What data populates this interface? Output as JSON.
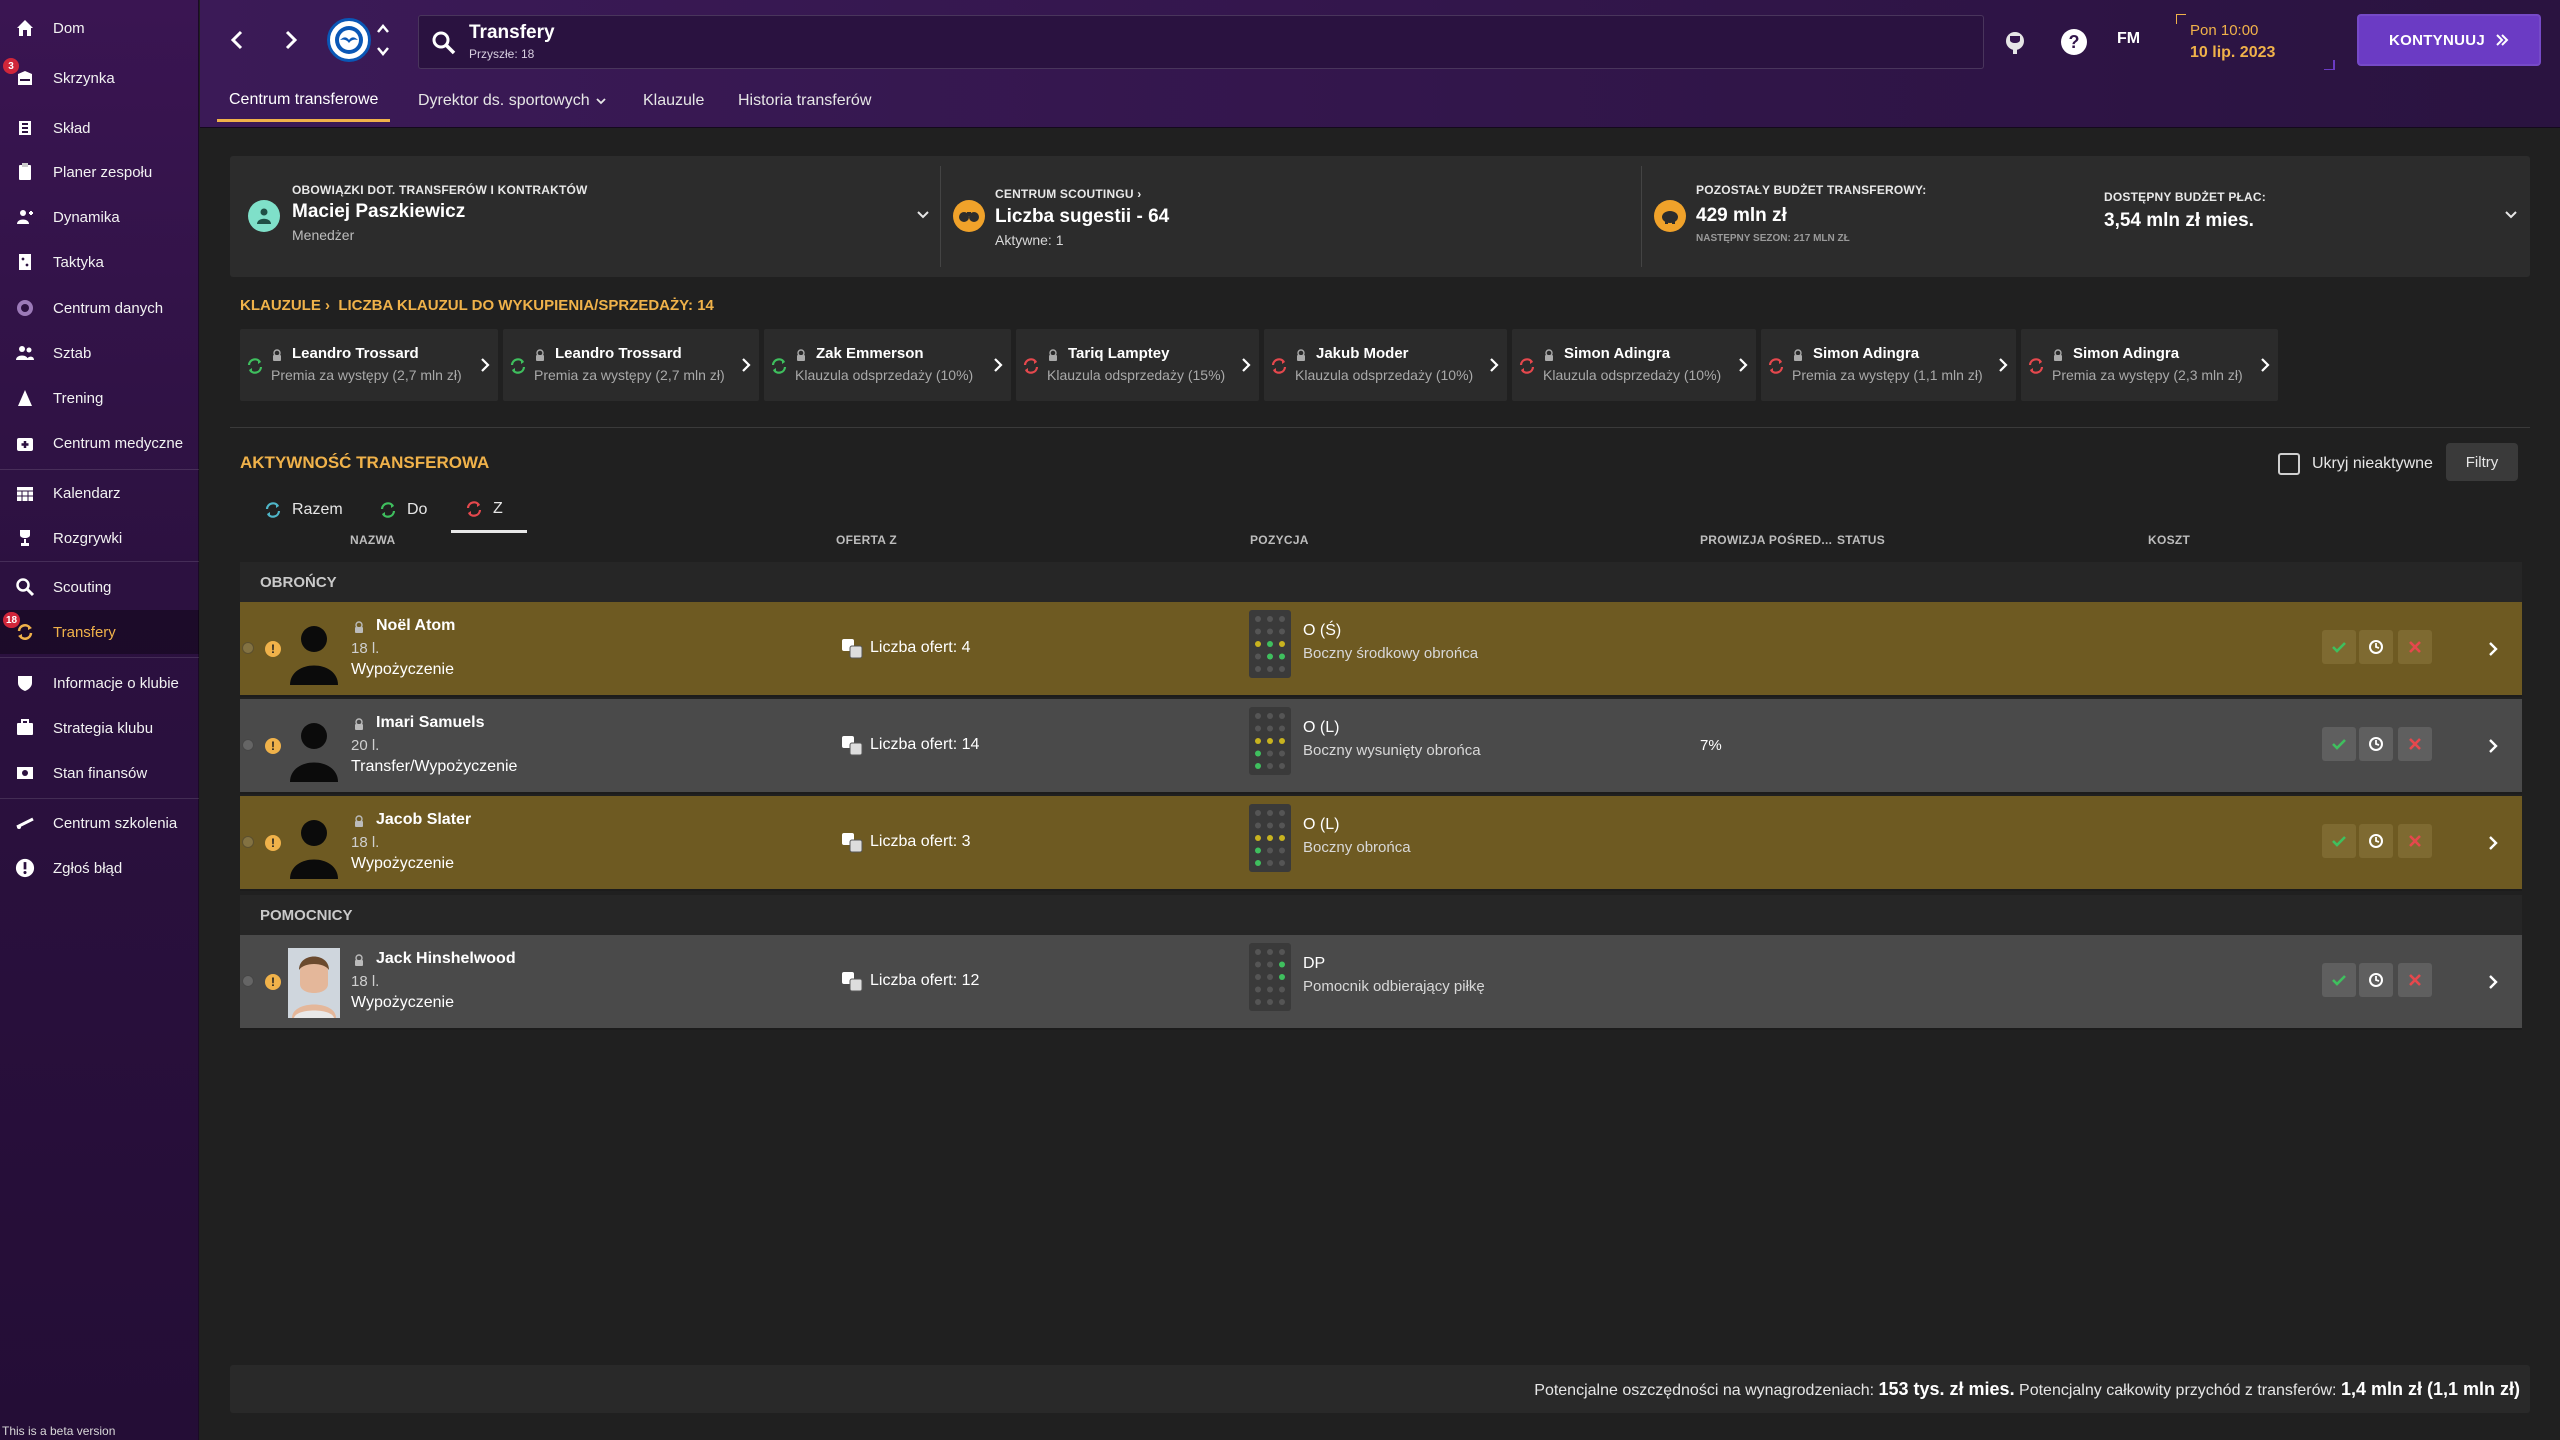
{
  "sidebar": {
    "items": [
      {
        "label": "Dom",
        "icon": "home-icon"
      },
      {
        "label": "Skrzynka",
        "icon": "inbox-icon",
        "badge": "3"
      },
      {
        "label": "Skład",
        "icon": "squad-icon"
      },
      {
        "label": "Planer zespołu",
        "icon": "clipboard-icon"
      },
      {
        "label": "Dynamika",
        "icon": "dynamics-icon"
      },
      {
        "label": "Taktyka",
        "icon": "tactics-icon"
      },
      {
        "label": "Centrum danych",
        "icon": "data-icon"
      },
      {
        "label": "Sztab",
        "icon": "staff-icon"
      },
      {
        "label": "Trening",
        "icon": "training-icon"
      },
      {
        "label": "Centrum medyczne",
        "icon": "medical-icon"
      },
      {
        "label": "Kalendarz",
        "icon": "calendar-icon"
      },
      {
        "label": "Rozgrywki",
        "icon": "trophy-icon"
      },
      {
        "label": "Scouting",
        "icon": "search-icon"
      },
      {
        "label": "Transfery",
        "icon": "transfer-icon",
        "badge": "18"
      },
      {
        "label": "Informacje o klubie",
        "icon": "shield-icon"
      },
      {
        "label": "Strategia klubu",
        "icon": "strategy-icon"
      },
      {
        "label": "Stan finansów",
        "icon": "finances-icon"
      },
      {
        "label": "Centrum szkolenia",
        "icon": "pitch-icon"
      },
      {
        "label": "Zgłoś błąd",
        "icon": "bug-report-icon"
      }
    ],
    "beta_note": "This is a beta version"
  },
  "header": {
    "title": "Transfery",
    "subtitle": "Przyszłe: 18",
    "fm_label": "FM",
    "time": "Pon 10:00",
    "date": "10 lip. 2023",
    "continue_label": "KONTYNUUJ",
    "tabs": [
      "Centrum transferowe",
      "Dyrektor ds. sportowych",
      "Klauzule",
      "Historia transferów"
    ]
  },
  "summary": {
    "duties_caption": "OBOWIĄZKI DOT. TRANSFERÓW I KONTRAKTÓW",
    "duties_name": "Maciej Paszkiewicz",
    "duties_role": "Menedżer",
    "scouting_caption": "CENTRUM SCOUTINGU",
    "scouting_value": "Liczba sugestii - 64",
    "scouting_active": "Aktywne: 1",
    "budget_caption": "POZOSTAŁY BUDŻET TRANSFEROWY:",
    "budget_value": "429 mln zł",
    "budget_next": "NASTĘPNY SEZON: 217 MLN ZŁ",
    "wage_caption": "DOSTĘPNY BUDŻET PŁAC:",
    "wage_value": "3,54 mln zł mies."
  },
  "clauses": {
    "title_link": "KLAUZULE",
    "title_count": "LICZBA KLAUZUL DO WYKUPIENIA/SPRZEDAŻY: 14",
    "cards": [
      {
        "name": "Leandro Trossard",
        "desc": "Premia za występy (2,7 mln zł)",
        "status": "green"
      },
      {
        "name": "Leandro Trossard",
        "desc": "Premia za występy (2,7 mln zł)",
        "status": "green"
      },
      {
        "name": "Zak Emmerson",
        "desc": "Klauzula odsprzedaży (10%)",
        "status": "green"
      },
      {
        "name": "Tariq Lamptey",
        "desc": "Klauzula odsprzedaży (15%)",
        "status": "red"
      },
      {
        "name": "Jakub Moder",
        "desc": "Klauzula odsprzedaży (10%)",
        "status": "red"
      },
      {
        "name": "Simon Adingra",
        "desc": "Klauzula odsprzedaży (10%)",
        "status": "red"
      },
      {
        "name": "Simon Adingra",
        "desc": "Premia za występy (1,1 mln zł)",
        "status": "red"
      },
      {
        "name": "Simon Adingra",
        "desc": "Premia za występy (2,3 mln zł)",
        "status": "red"
      }
    ]
  },
  "activity": {
    "title": "AKTYWNOŚĆ TRANSFEROWA",
    "hide_inactive": "Ukryj nieaktywne",
    "filters": "Filtry",
    "subtabs": [
      "Razem",
      "Do",
      "Z"
    ],
    "columns": [
      "NAZWA",
      "OFERTA Z",
      "POZYCJA",
      "PROWIZJA POŚRED...",
      "STATUS",
      "KOSZT"
    ],
    "groups": [
      {
        "title": "OBROŃCY",
        "rows": [
          {
            "name": "Noël Atom",
            "age": "18 l.",
            "type": "Wypożyczenie",
            "offers": "Liczba ofert: 4",
            "pos": "O (Ś)",
            "role": "Boczny środkowy obrońca",
            "commission": "",
            "style": "warn"
          },
          {
            "name": "Imari Samuels",
            "age": "20 l.",
            "type": "Transfer/Wypożyczenie",
            "offers": "Liczba ofert: 14",
            "pos": "O (L)",
            "role": "Boczny wysunięty obrońca",
            "commission": "7%",
            "style": "grey"
          },
          {
            "name": "Jacob Slater",
            "age": "18 l.",
            "type": "Wypożyczenie",
            "offers": "Liczba ofert: 3",
            "pos": "O (L)",
            "role": "Boczny obrońca",
            "commission": "",
            "style": "warn"
          }
        ]
      },
      {
        "title": "POMOCNICY",
        "rows": [
          {
            "name": "Jack Hinshelwood",
            "age": "18 l.",
            "type": "Wypożyczenie",
            "offers": "Liczba ofert: 12",
            "pos": "DP",
            "role": "Pomocnik odbierający piłkę",
            "commission": "",
            "style": "grey"
          }
        ]
      }
    ]
  },
  "footer": {
    "savings_label": "Potencjalne oszczędności na wynagrodzeniach:",
    "savings_value": "153 tys. zł mies.",
    "income_label": "Potencjalny całkowity przychód z transferów:",
    "income_value": "1,4 mln zł (1,1 mln zł)"
  },
  "colors": {
    "accent": "#f0b24a",
    "continue": "#6b3bc4",
    "warn_row": "#6e5a22",
    "grey_row": "#4a4a4a"
  }
}
